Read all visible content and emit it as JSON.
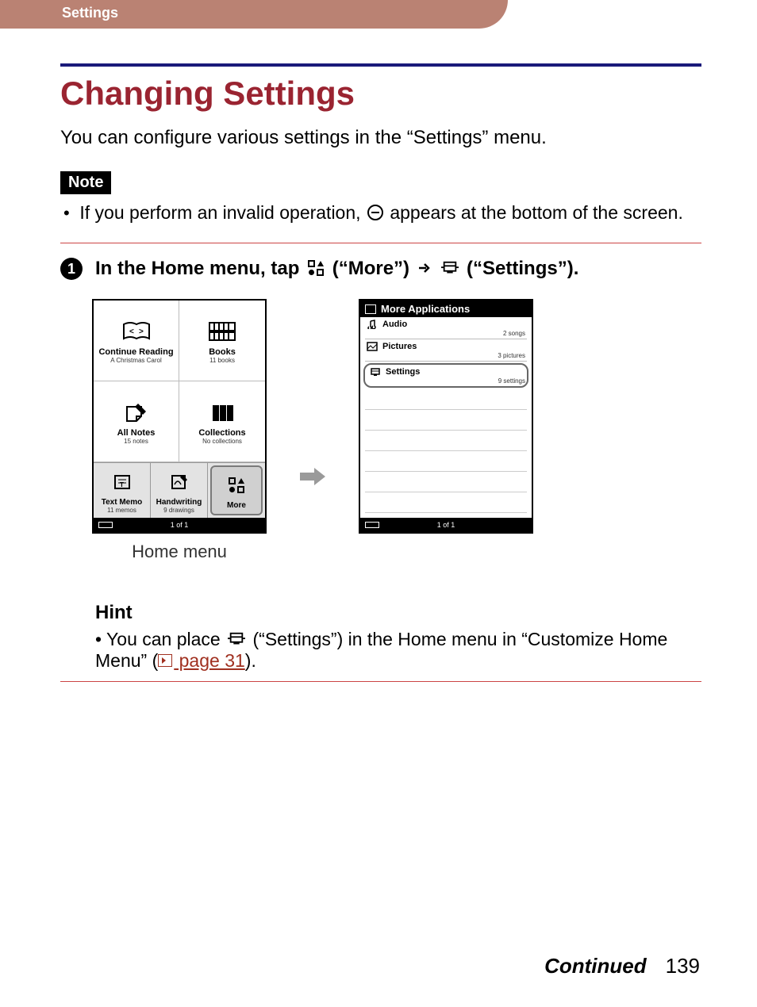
{
  "header": {
    "section": "Settings"
  },
  "title": "Changing Settings",
  "intro": "You can configure various settings in the “Settings” menu.",
  "note": {
    "label": "Note",
    "text_before_icon": "If you perform an invalid operation, ",
    "text_after_icon": " appears at the bottom of the screen."
  },
  "step": {
    "number": "1",
    "part1": "In the Home menu, tap ",
    "more_label": " (“More”) ",
    "settings_label": " (“Settings”)."
  },
  "figures": {
    "home_caption": "Home menu",
    "home": {
      "cells": [
        {
          "title": "Continue Reading",
          "sub": "A Christmas Carol"
        },
        {
          "title": "Books",
          "sub": "11 books"
        },
        {
          "title": "All Notes",
          "sub": "15 notes"
        },
        {
          "title": "Collections",
          "sub": "No collections"
        }
      ],
      "bottom": [
        {
          "title": "Text Memo",
          "sub": "11 memos"
        },
        {
          "title": "Handwriting",
          "sub": "9 drawings"
        },
        {
          "title": "More",
          "sub": ""
        }
      ],
      "status": "1 of 1"
    },
    "list": {
      "header": "More Applications",
      "rows": [
        {
          "name": "Audio",
          "count": "2 songs"
        },
        {
          "name": "Pictures",
          "count": "3 pictures"
        },
        {
          "name": "Settings",
          "count": "9 settings",
          "selected": true
        }
      ],
      "status": "1 of 1"
    }
  },
  "hint": {
    "title": "Hint",
    "text_before": "You can place ",
    "text_mid": " (“Settings”) in the Home menu in “Customize Home Menu” (",
    "link": " page 31",
    "text_after": ")."
  },
  "footer": {
    "continued": "Continued",
    "page": "139"
  }
}
